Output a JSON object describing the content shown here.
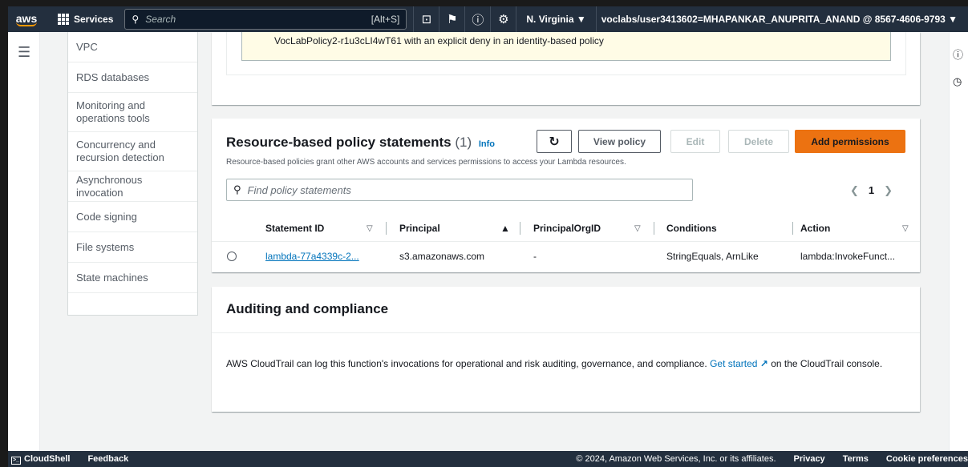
{
  "topnav": {
    "logo": "aws",
    "services": "Services",
    "search_placeholder": "Search",
    "search_shortcut": "[Alt+S]",
    "region": "N. Virginia ▼",
    "account": "voclabs/user3413602=MHAPANKAR_ANUPRITA_ANAND @ 8567-4606-9793 ▼",
    "icons": [
      "cloudshell-icon",
      "bell-icon",
      "help-icon",
      "settings-icon"
    ]
  },
  "sidenav": {
    "items": [
      "VPC",
      "RDS databases",
      "Monitoring and operations tools",
      "Concurrency and recursion detection",
      "Asynchronous invocation",
      "Code signing",
      "File systems",
      "State machines"
    ]
  },
  "alert": {
    "text": "VocLabPolicy2-r1u3cLI4wT61 with an explicit deny in an identity-based policy"
  },
  "resource_policy": {
    "title": "Resource-based policy statements",
    "count": "(1)",
    "info": "Info",
    "description": "Resource-based policies grant other AWS accounts and services permissions to access your Lambda resources.",
    "buttons": {
      "view": "View policy",
      "edit": "Edit",
      "delete": "Delete",
      "add": "Add permissions"
    },
    "search_placeholder": "Find policy statements",
    "page": "1",
    "columns": [
      "Statement ID",
      "Principal",
      "PrincipalOrgID",
      "Conditions",
      "Action"
    ],
    "rows": [
      {
        "statement_id": "lambda-77a4339c-2...",
        "principal": "s3.amazonaws.com",
        "principal_org_id": "-",
        "conditions": "StringEquals, ArnLike",
        "action": "lambda:InvokeFunct..."
      }
    ]
  },
  "auditing": {
    "title": "Auditing and compliance",
    "text_before": "AWS CloudTrail can log this function's invocations for operational and risk auditing, governance, and compliance.",
    "link": "Get started",
    "text_after": "on the CloudTrail console."
  },
  "footer": {
    "cloudshell": "CloudShell",
    "feedback": "Feedback",
    "copyright": "© 2024, Amazon Web Services, Inc. or its affiliates.",
    "privacy": "Privacy",
    "terms": "Terms",
    "cookies": "Cookie preferences"
  },
  "colors": {
    "nav_bg": "#232f3e",
    "accent_orange": "#ec7211",
    "link_blue": "#0073bb"
  }
}
